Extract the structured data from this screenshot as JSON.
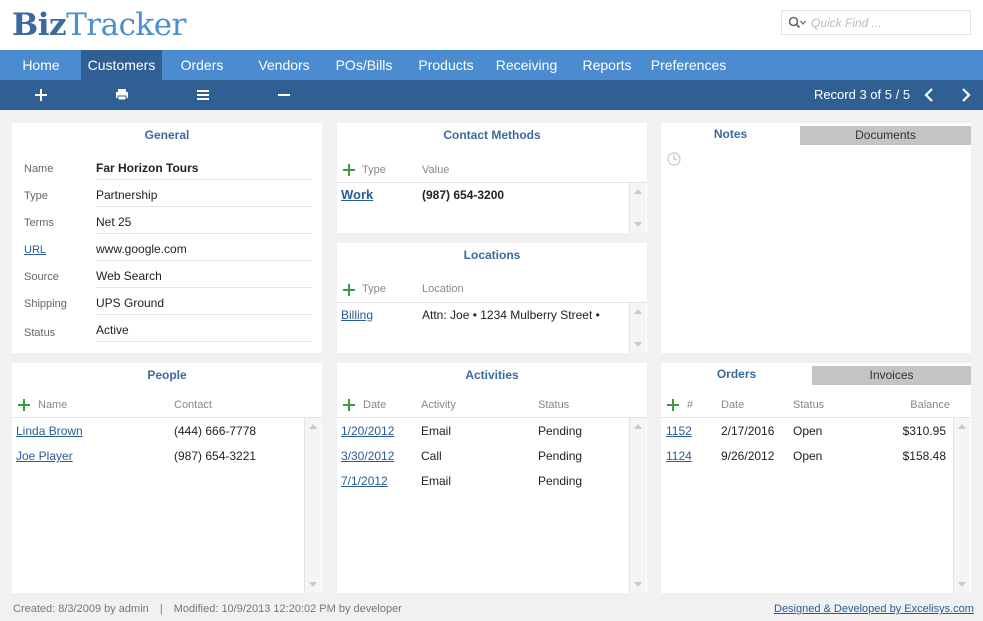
{
  "app": {
    "logo_part1": "Biz",
    "logo_part2": "Tracker"
  },
  "search": {
    "placeholder": "Quick Find ..."
  },
  "nav": {
    "tabs": [
      "Home",
      "Customers",
      "Orders",
      "Vendors",
      "POs/Bills",
      "Products",
      "Receiving",
      "Reports",
      "Preferences"
    ],
    "active": "Customers"
  },
  "toolbar": {
    "icons": [
      "plus-icon",
      "print-icon",
      "list-icon",
      "minus-icon",
      "chevron-left-icon",
      "chevron-right-icon"
    ],
    "record_text": "Record 3 of 5 / 5"
  },
  "general": {
    "title": "General",
    "fields": [
      {
        "label": "Name",
        "value": "Far Horizon Tours"
      },
      {
        "label": "Type",
        "value": "Partnership"
      },
      {
        "label": "Terms",
        "value": "Net 25"
      },
      {
        "label": "URL",
        "value": "www.google.com"
      },
      {
        "label": "Source",
        "value": "Web Search"
      },
      {
        "label": "Shipping",
        "value": "UPS Ground"
      },
      {
        "label": "Status",
        "value": "Active"
      }
    ]
  },
  "contact_methods": {
    "title": "Contact Methods",
    "columns": [
      "Type",
      "Value"
    ],
    "rows": [
      {
        "type": "Work",
        "value": "(987) 654-3200"
      }
    ]
  },
  "locations": {
    "title": "Locations",
    "columns": [
      "Type",
      "Location"
    ],
    "rows": [
      {
        "type": "Billing",
        "location": "Attn: Joe • 1234 Mulberry Street •"
      }
    ]
  },
  "notes_docs": {
    "tabs": [
      "Notes",
      "Documents"
    ],
    "active": "Notes",
    "icon": "clock-icon"
  },
  "people": {
    "title": "People",
    "columns": [
      "Name",
      "Contact"
    ],
    "rows": [
      {
        "name": "Linda Brown",
        "contact": "(444) 666-7778"
      },
      {
        "name": "Joe Player",
        "contact": "(987) 654-3221"
      }
    ]
  },
  "activities": {
    "title": "Activities",
    "columns": [
      "Date",
      "Activity",
      "Status"
    ],
    "rows": [
      {
        "date": "1/20/2012",
        "activity": "Email",
        "status": "Pending"
      },
      {
        "date": "3/30/2012",
        "activity": "Call",
        "status": "Pending"
      },
      {
        "date": "7/1/2012",
        "activity": "Email",
        "status": "Pending"
      }
    ]
  },
  "orders": {
    "tabs": [
      "Orders",
      "Invoices"
    ],
    "active": "Orders",
    "columns": [
      "#",
      "Date",
      "Status",
      "Balance"
    ],
    "rows": [
      {
        "num": "1152",
        "date": "2/17/2016",
        "status": "Open",
        "balance": "$310.95"
      },
      {
        "num": "1124",
        "date": "9/26/2012",
        "status": "Open",
        "balance": "$158.48"
      }
    ]
  },
  "footer": {
    "created": "Created: 8/3/2009 by admin",
    "separator": "|",
    "modified": "Modified: 10/9/2013 12:20:02 PM by developer",
    "credit": "Designed & Developed by Excelisys.com"
  },
  "colors": {
    "brand": "#3b6a9e",
    "nav": "#4b8bcf",
    "nav_active": "#2f5f93",
    "link": "#2a5c95",
    "add": "#3c9a3c"
  }
}
